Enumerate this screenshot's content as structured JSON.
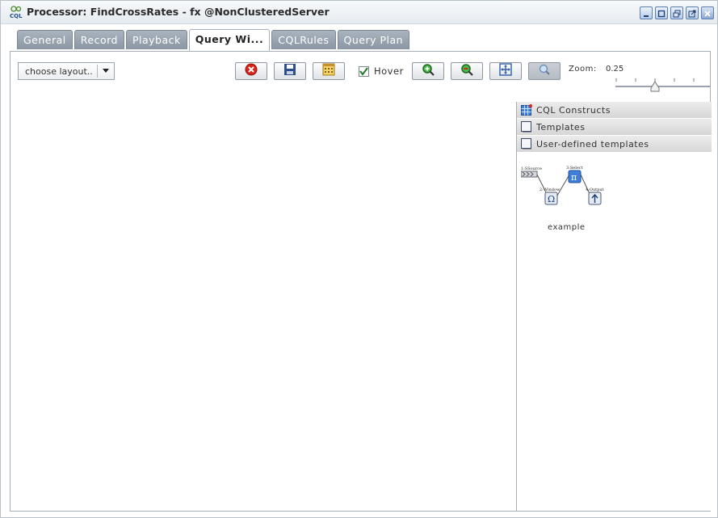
{
  "window": {
    "title": "Processor: FindCrossRates - fx @NonClusteredServer",
    "app_icon_text": "CQL",
    "buttons": [
      "minimize-icon",
      "maximize-icon",
      "restore-icon",
      "popout-icon",
      "close-icon"
    ]
  },
  "tabs": [
    {
      "label": "General",
      "active": false
    },
    {
      "label": "Record",
      "active": false
    },
    {
      "label": "Playback",
      "active": false
    },
    {
      "label": "Query Wi...",
      "active": true
    },
    {
      "label": "CQLRules",
      "active": false
    },
    {
      "label": "Query Plan",
      "active": false
    }
  ],
  "toolbar": {
    "layout_select_value": "choose layout..",
    "hover_label": "Hover",
    "hover_checked": true,
    "zoom_label": "Zoom:",
    "zoom_value": "0.25",
    "zoom_fraction": 0.5
  },
  "palette": {
    "sections": [
      {
        "label": "CQL Constructs",
        "icon": "grid-icon"
      },
      {
        "label": "Templates",
        "icon": "template-icon"
      },
      {
        "label": "User-defined templates",
        "icon": "template-icon"
      }
    ],
    "template": {
      "caption": "example",
      "nodes": [
        "1:SSource",
        "2:Window",
        "3:Select",
        "4:Output"
      ]
    }
  },
  "colors": {
    "tab_inactive": "#97a2ae",
    "accent_blue": "#3d7fd9"
  }
}
